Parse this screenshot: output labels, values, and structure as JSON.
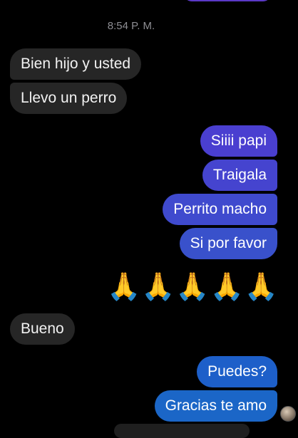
{
  "conversation": {
    "timestamp": "8:54 P. M.",
    "messages": [
      {
        "text": "Bien hijo y usted",
        "direction": "incoming"
      },
      {
        "text": "Llevo un perro",
        "direction": "incoming"
      },
      {
        "text": "Siiii papi",
        "direction": "outgoing",
        "color": "#4a3fd0"
      },
      {
        "text": "Traigala",
        "direction": "outgoing",
        "color": "#4544cf"
      },
      {
        "text": "Perrito macho",
        "direction": "outgoing",
        "color": "#3f4ace"
      },
      {
        "text": "Si por favor",
        "direction": "outgoing",
        "color": "#3951cb"
      },
      {
        "text": "🙏🙏🙏🙏🙏",
        "direction": "outgoing",
        "type": "emoji",
        "count": 5
      },
      {
        "text": "Bueno",
        "direction": "incoming"
      },
      {
        "text": "Puedes?",
        "direction": "outgoing",
        "color": "#1d5fc9"
      },
      {
        "text": "Gracias te amo",
        "direction": "outgoing",
        "color": "#1b66c7"
      }
    ],
    "emoji_glyph": "🙏",
    "incoming_bubble_color": "#262626",
    "avatar_icon": "contact-avatar"
  }
}
